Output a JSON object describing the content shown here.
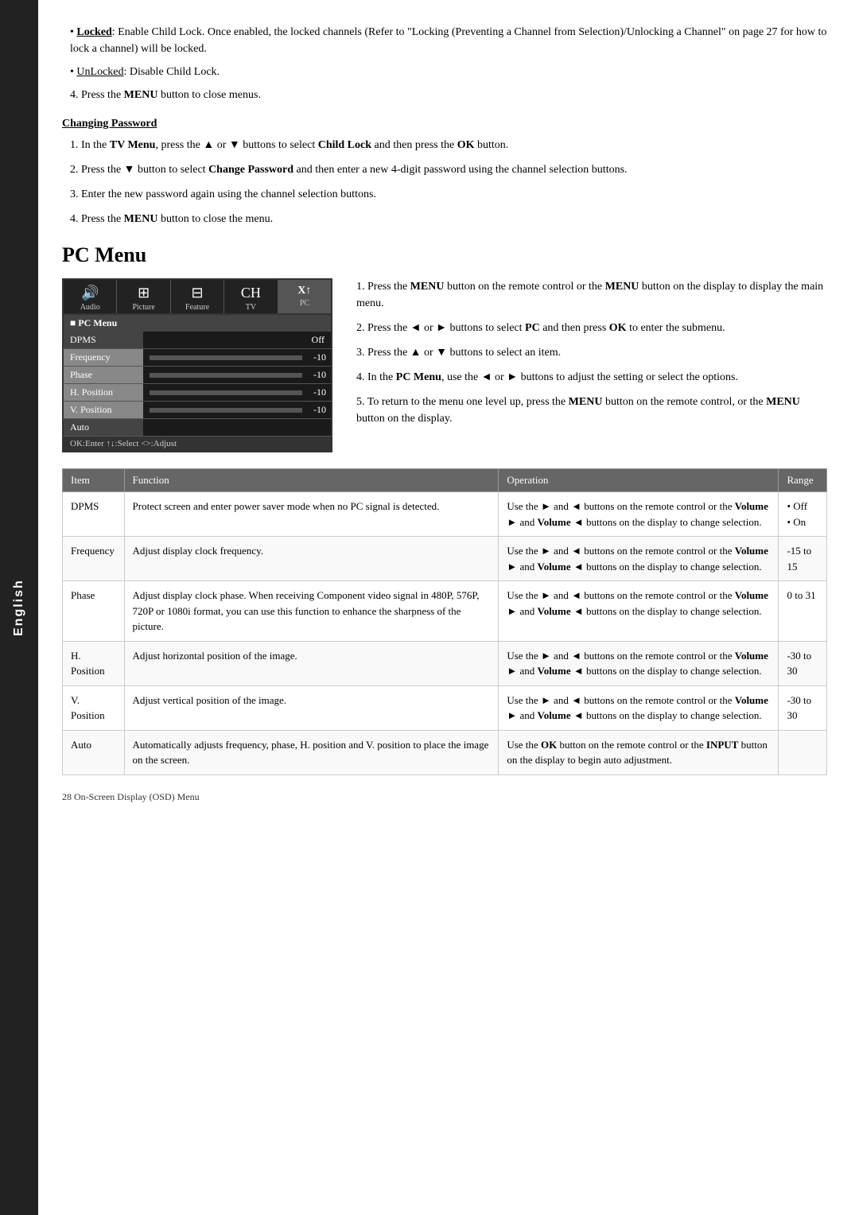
{
  "sidebar": {
    "label": "English"
  },
  "bullet_section": {
    "locked_label": "Locked",
    "locked_text": ": Enable Child Lock. Once enabled, the locked channels (Refer to \"Locking (Preventing a Channel from Selection)/Unlocking a Channel\" on page  27 for how to lock a channel) will be locked.",
    "unlocked_label": "UnLocked",
    "unlocked_text": ": Disable Child Lock.",
    "press_menu": "4. Press the",
    "menu_bold": "MENU",
    "press_menu_suffix": " button to close menus."
  },
  "changing_password": {
    "heading": "Changing Password",
    "step1": "1. In the TV Menu, press the ▲ or ▼ buttons to select Child Lock and then press the OK button.",
    "step2": "2. Press the ▼ button to select Change Password and then enter a new 4-digit password using the channel selection buttons.",
    "step3": "3. Enter the new password again using the channel selection buttons.",
    "step4": "4. Press the MENU button to close the menu."
  },
  "pc_menu": {
    "heading": "PC Menu",
    "osd": {
      "icons": [
        {
          "symbol": "🔊",
          "label": "Audio",
          "active": false
        },
        {
          "symbol": "🖼",
          "label": "Picture",
          "active": false
        },
        {
          "symbol": "⚙",
          "label": "Feature",
          "active": false
        },
        {
          "symbol": "📺",
          "label": "TV",
          "active": false
        },
        {
          "symbol": "🖥",
          "label": "PC",
          "active": true
        }
      ],
      "menu_title": "■ PC Menu",
      "rows": [
        {
          "label": "DPMS",
          "value": "Off",
          "has_bar": false
        },
        {
          "label": "Frequency",
          "value": "-10",
          "has_bar": true
        },
        {
          "label": "Phase",
          "value": "-10",
          "has_bar": true
        },
        {
          "label": "H. Position",
          "value": "-10",
          "has_bar": true
        },
        {
          "label": "V. Position",
          "value": "-10",
          "has_bar": true
        },
        {
          "label": "Auto",
          "value": "",
          "has_bar": false
        }
      ],
      "bottom_bar": "OK:Enter  ↑↓:Select  <>:Adjust"
    },
    "steps": [
      {
        "num": "1.",
        "text": "Press the MENU button on the remote control or the MENU button on the display to display the main menu."
      },
      {
        "num": "2.",
        "text": "Press the ◄ or ► buttons to select PC and then press OK to enter the submenu."
      },
      {
        "num": "3.",
        "text": "Press the ▲ or ▼ buttons to select an item."
      },
      {
        "num": "4.",
        "text": "In the PC Menu, use the ◄ or ► buttons to adjust the setting or select the options."
      },
      {
        "num": "5.",
        "text": "To return to the menu one level up, press the MENU button on the remote control, or the MENU button on the display."
      }
    ]
  },
  "table": {
    "headers": [
      "Item",
      "Function",
      "Operation",
      "Range"
    ],
    "rows": [
      {
        "item": "DPMS",
        "function": "Protect screen and enter power saver mode when no PC signal is detected.",
        "operation": "Use the ► and ◄ buttons on the remote control or the Volume ► and Volume ◄ buttons on the display to change selection.",
        "range": "• Off\n• On"
      },
      {
        "item": "Frequency",
        "function": "Adjust display clock frequency.",
        "operation": "Use the ► and ◄ buttons on the remote control or the Volume ► and Volume ◄ buttons on the display to change selection.",
        "range": "-15 to 15"
      },
      {
        "item": "Phase",
        "function": "Adjust display clock phase. When receiving Component video signal in 480P, 576P, 720P or 1080i format, you can use this function to enhance the sharpness of the picture.",
        "operation": "Use the ► and ◄ buttons on the remote control or the Volume ► and Volume ◄ buttons on the display to change selection.",
        "range": "0 to 31"
      },
      {
        "item": "H. Position",
        "function": "Adjust horizontal position of the image.",
        "operation": "Use the ► and ◄ buttons on the remote control or the Volume ► and Volume ◄ buttons on the display to change selection.",
        "range": "-30 to 30"
      },
      {
        "item": "V. Position",
        "function": "Adjust vertical position of the image.",
        "operation": "Use the ► and ◄ buttons on the remote control or the Volume ► and Volume ◄ buttons on the display to change selection.",
        "range": "-30 to 30"
      },
      {
        "item": "Auto",
        "function": "Automatically adjusts frequency, phase, H. position and V. position to place the image on the screen.",
        "operation": "Use the OK button on the remote control or the INPUT button on the display to begin auto adjustment.",
        "range": ""
      }
    ]
  },
  "footer": {
    "text": "28   On-Screen Display (OSD) Menu"
  }
}
